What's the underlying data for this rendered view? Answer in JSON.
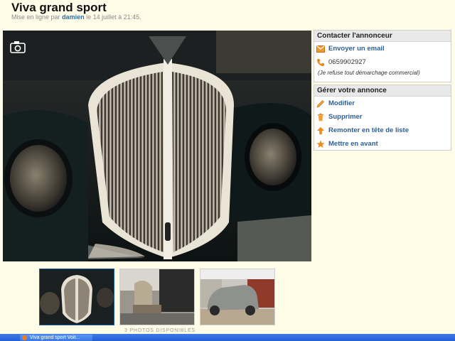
{
  "listing": {
    "title": "Viva grand sport",
    "posted_prefix": "Mise en ligne par",
    "author": "damien",
    "posted_suffix": "le 14 juillet à 21:45."
  },
  "contact": {
    "header": "Contacter l'annonceur",
    "email_label": "Envoyer un email",
    "phone": "0659902927",
    "note": "(Je refuse tout démarchage commercial)"
  },
  "manage": {
    "header": "Gérer votre annonce",
    "edit": "Modifier",
    "delete": "Supprimer",
    "bump": "Remonter en tête de liste",
    "feature": "Mettre en avant"
  },
  "photos": {
    "count_label": "3 PHOTOS DISPONIBLES",
    "selected_index": 1
  },
  "taskbar": {
    "window_title": "Viva grand sport Voit..."
  },
  "colors": {
    "background": "#fffde8",
    "link": "#2d5f97",
    "taskbar": "#245edb"
  },
  "icons": {
    "email": "envelope-icon",
    "phone": "phone-icon",
    "edit": "pencil-icon",
    "delete": "trash-icon",
    "bump": "up-arrow-icon",
    "feature": "star-icon",
    "camera": "camera-icon"
  }
}
